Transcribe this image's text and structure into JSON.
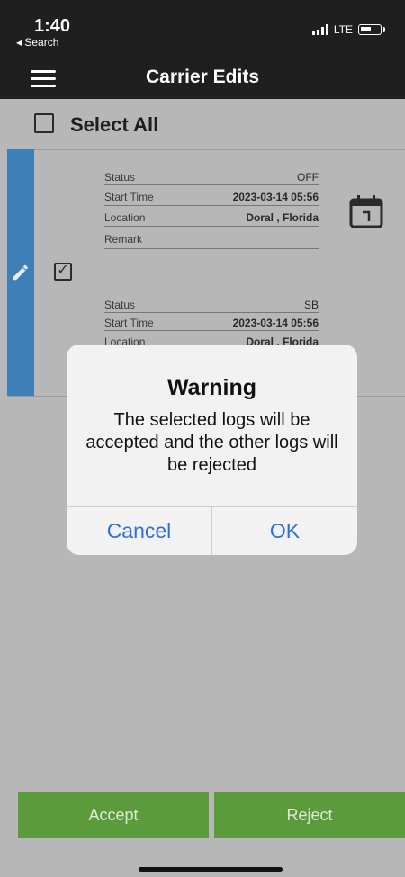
{
  "status_bar": {
    "time": "1:40",
    "back_label": "◂ Search",
    "network": "LTE"
  },
  "header": {
    "title": "Carrier Edits"
  },
  "select_all": {
    "label": "Select All"
  },
  "logs": [
    {
      "status_label": "Status",
      "status_value": "OFF",
      "start_label": "Start Time",
      "start_value": "2023-03-14  05:56",
      "location_label": "Location",
      "location_value": "Doral , Florida",
      "remark_label": "Remark",
      "remark_value": ""
    },
    {
      "status_label": "Status",
      "status_value": "SB",
      "start_label": "Start Time",
      "start_value": "2023-03-14  05:56",
      "location_label": "Location",
      "location_value": "Doral , Florida"
    }
  ],
  "dialog": {
    "title": "Warning",
    "message": "The selected logs will be accepted and the other logs will be rejected",
    "cancel_label": "Cancel",
    "ok_label": "OK"
  },
  "actions": {
    "accept_label": "Accept",
    "reject_label": "Reject"
  },
  "colors": {
    "header_bg": "#1f1f1f",
    "accent_blue": "#3d7fb7",
    "button_green": "#5c9b3c",
    "dialog_link": "#2f6fdc"
  },
  "icons": [
    "menu-icon",
    "calendar-icon",
    "pencil-icon",
    "checkbox-checked-icon"
  ]
}
